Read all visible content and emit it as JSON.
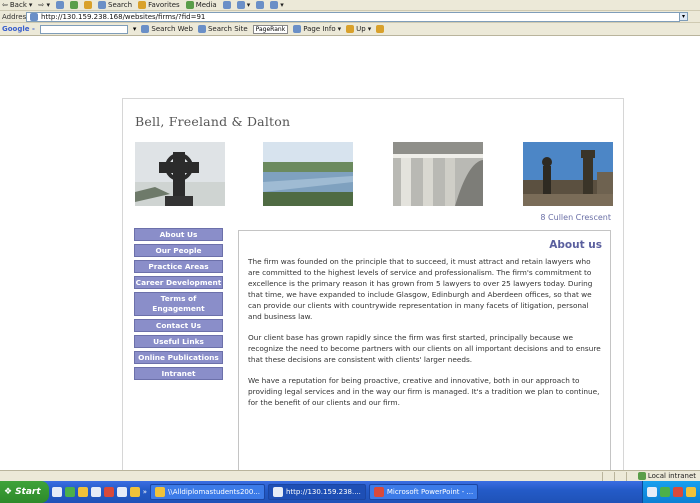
{
  "browser": {
    "toolbar": {
      "back": "Back",
      "search": "Search",
      "favorites": "Favorites",
      "media": "Media"
    },
    "address": {
      "label": "Address",
      "url": "http://130.159.238.168/websites/firms/?fid=91"
    },
    "google": {
      "logo": "Google -",
      "search_web": "Search Web",
      "search_site": "Search Site",
      "pagerank": "PageRank",
      "page_info": "Page Info",
      "up": "Up"
    },
    "status": {
      "zone": "Local intranet"
    }
  },
  "site": {
    "title": "Bell, Freeland & Dalton",
    "address_caption": "8 Cullen Crescent",
    "nav": [
      {
        "label": "About Us"
      },
      {
        "label": "Our People"
      },
      {
        "label": "Practice Areas"
      },
      {
        "label": "Career Development"
      },
      {
        "label": "Terms of Engagement"
      },
      {
        "label": "Contact Us"
      },
      {
        "label": "Useful Links"
      },
      {
        "label": "Online Publications"
      },
      {
        "label": "Intranet"
      }
    ],
    "content": {
      "heading": "About us",
      "paragraphs": [
        "The firm was founded on the principle that to succeed, it must attract and retain lawyers who are committed to the highest levels of service and professionalism. The firm's commitment to excellence is the primary reason it has grown from 5 lawyers to over 25 lawyers today. During that time, we have expanded to include Glasgow, Edinburgh and Aberdeen offices, so that we can provide our clients with countrywide representation in many facets of litigation, personal and business law.",
        "Our client base has grown rapidly since the firm was first started, principally because we recognize the need to become partners with our clients on all important decisions and to ensure that these decisions are consistent with clients' larger needs.",
        "We have a reputation for being proactive, creative and innovative, both in our approach to providing legal services and in the way our firm is managed. It's a tradition we plan to continue, for the benefit of our clients and our firm."
      ]
    }
  },
  "taskbar": {
    "start": "Start",
    "tasks": [
      {
        "label": "\\\\Alldiplomastudents200..."
      },
      {
        "label": "http://130.159.238...."
      },
      {
        "label": "Microsoft PowerPoint - ..."
      }
    ]
  }
}
